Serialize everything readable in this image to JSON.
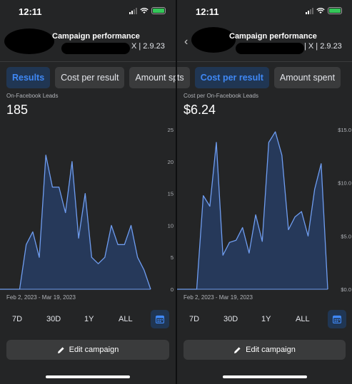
{
  "left": {
    "time": "12:11",
    "header": {
      "title": "Campaign performance",
      "subtitle": "X | 2.9.23"
    },
    "tabs": [
      {
        "label": "Results",
        "active": true
      },
      {
        "label": "Cost per result",
        "active": false
      },
      {
        "label": "Amount spent",
        "active": false
      }
    ],
    "metric_label": "On-Facebook Leads",
    "metric_value": "185",
    "date_range": "Feb 2, 2023 - Mar 19, 2023",
    "ranges": [
      "7D",
      "30D",
      "1Y",
      "ALL"
    ],
    "edit_label": "Edit campaign",
    "chart_data": {
      "type": "area",
      "color": "#6f9df0",
      "fill": "#26395a",
      "y_ticks": [
        "25",
        "20",
        "15",
        "10",
        "5",
        "0"
      ],
      "ylim": [
        0,
        25
      ],
      "values": [
        0,
        0,
        0,
        0,
        7,
        9,
        5,
        21,
        16,
        16,
        12,
        20,
        8,
        15,
        5,
        4,
        5,
        10,
        7,
        7,
        10,
        5,
        3,
        0
      ]
    }
  },
  "right": {
    "time": "12:11",
    "header": {
      "title": "Campaign performance",
      "subtitle": "| X | 2.9.23"
    },
    "tabs": [
      {
        "label": "Results",
        "active": false
      },
      {
        "label": "Cost per result",
        "active": true
      },
      {
        "label": "Amount spent",
        "active": false
      }
    ],
    "metric_label": "Cost per On-Facebook Leads",
    "metric_value": "$6.24",
    "date_range": "Feb 2, 2023 - Mar 19, 2023",
    "ranges": [
      "7D",
      "30D",
      "1Y",
      "ALL"
    ],
    "edit_label": "Edit campaign",
    "chart_data": {
      "type": "area",
      "color": "#6f9df0",
      "fill": "#26395a",
      "y_ticks": [
        "$15.0",
        "$10.0",
        "$5.0",
        "$0.0"
      ],
      "ylim": [
        0,
        15
      ],
      "values": [
        0,
        0,
        0,
        0,
        8.8,
        7.8,
        13.8,
        3.2,
        4.4,
        4.6,
        5.8,
        3.4,
        7.0,
        4.5,
        13.8,
        14.8,
        12.6,
        5.6,
        6.8,
        7.3,
        5.0,
        9.4,
        11.8,
        0
      ]
    }
  },
  "icons": {
    "calendar": "calendar-icon",
    "pencil": "pencil-icon",
    "back": "chevron-left-icon"
  },
  "colors": {
    "accent": "#3f88f5",
    "active_tab_bg": "#203653",
    "panel_bg": "#242526"
  }
}
